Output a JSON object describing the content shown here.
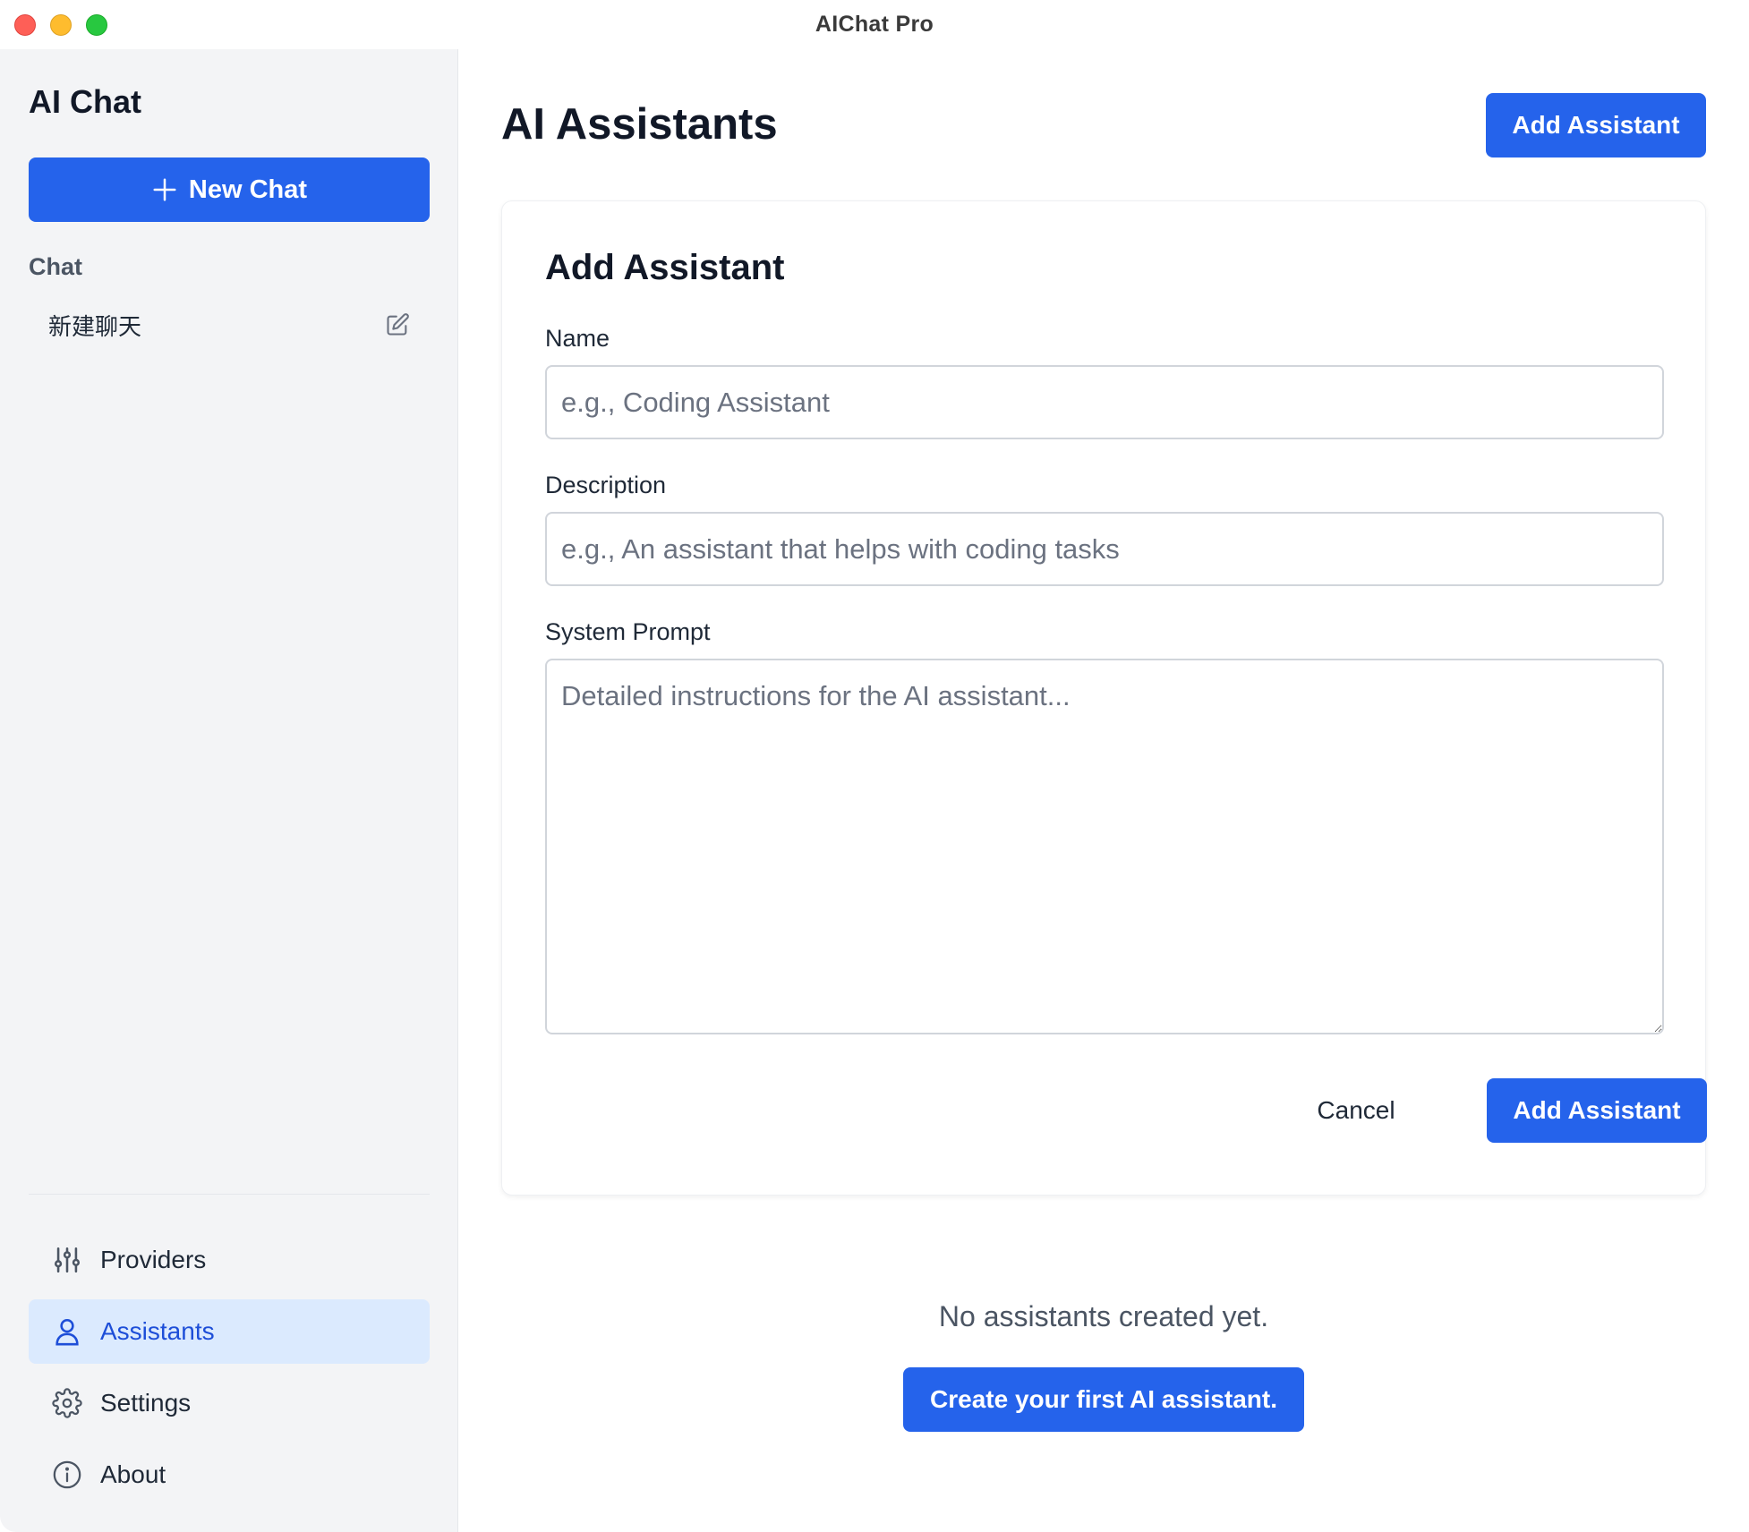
{
  "window": {
    "title": "AIChat Pro"
  },
  "sidebar": {
    "brand": "AI Chat",
    "new_chat_label": "New Chat",
    "section_label": "Chat",
    "chats": [
      {
        "label": "新建聊天"
      }
    ],
    "nav": [
      {
        "label": "Providers",
        "icon": "sliders-icon"
      },
      {
        "label": "Assistants",
        "icon": "user-icon",
        "active": true
      },
      {
        "label": "Settings",
        "icon": "gear-icon"
      },
      {
        "label": "About",
        "icon": "info-icon"
      }
    ]
  },
  "main": {
    "title": "AI Assistants",
    "add_button_label": "Add Assistant",
    "form": {
      "title": "Add Assistant",
      "name_label": "Name",
      "name_placeholder": "e.g., Coding Assistant",
      "name_value": "",
      "description_label": "Description",
      "description_placeholder": "e.g., An assistant that helps with coding tasks",
      "description_value": "",
      "prompt_label": "System Prompt",
      "prompt_placeholder": "Detailed instructions for the AI assistant...",
      "prompt_value": "",
      "cancel_label": "Cancel",
      "submit_label": "Add Assistant"
    },
    "empty_state": {
      "text": "No assistants created yet.",
      "cta_label": "Create your first AI assistant."
    }
  },
  "colors": {
    "accent": "#2563eb",
    "active_nav_bg": "#dbeafe",
    "active_nav_text": "#1d4ed8",
    "sidebar_bg": "#f3f4f6"
  }
}
